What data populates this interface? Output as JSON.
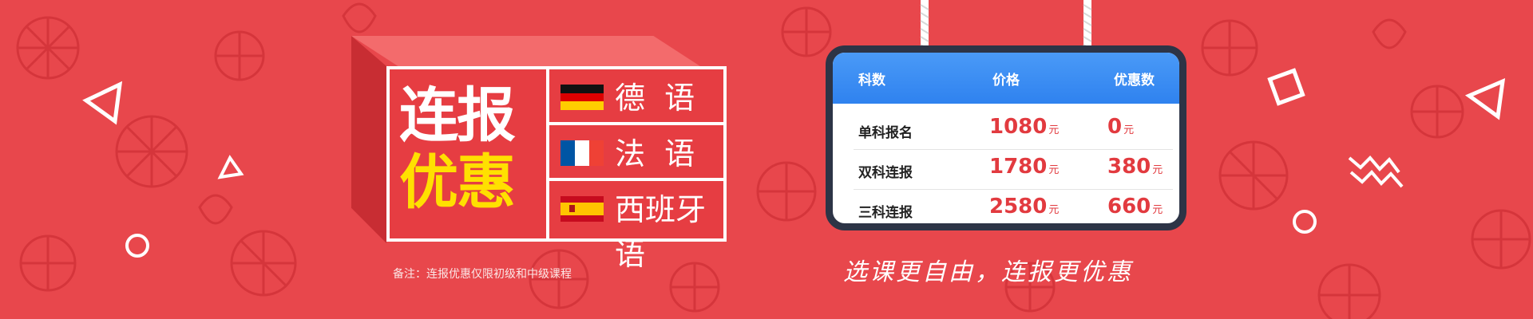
{
  "promo": {
    "title_line1": "连报",
    "title_line2": "优惠",
    "languages": [
      {
        "name": "德  语",
        "flag": "germany-flag-icon"
      },
      {
        "name": "法  语",
        "flag": "france-flag-icon"
      },
      {
        "name": "西班牙语",
        "flag": "spain-flag-icon"
      }
    ],
    "note": "备注：连报优惠仅限初级和中级课程"
  },
  "price_table": {
    "headers": [
      "科数",
      "价格",
      "优惠数"
    ],
    "unit": "元",
    "rows": [
      {
        "name": "单科报名",
        "price": "1080",
        "discount": "0"
      },
      {
        "name": "双科连报",
        "price": "1780",
        "discount": "380"
      },
      {
        "name": "三科连报",
        "price": "2580",
        "discount": "660"
      }
    ]
  },
  "slogan": "选课更自由，连报更优惠",
  "colors": {
    "background": "#e8474c",
    "accent_yellow": "#ffe000",
    "table_header_blue": "#2f82ef",
    "price_red": "#e23a3f",
    "card_border": "#2d3446"
  }
}
